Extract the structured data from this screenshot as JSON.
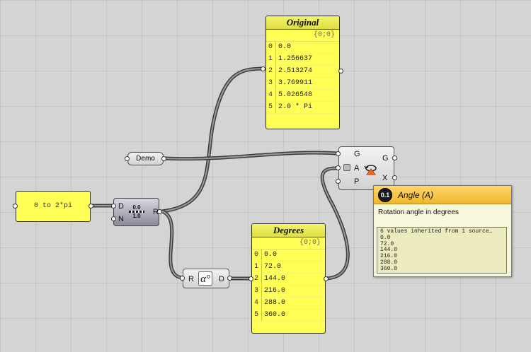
{
  "original_panel": {
    "title": "Original",
    "path": "{0;0}",
    "rows": [
      {
        "index": "0",
        "value": "0.0"
      },
      {
        "index": "1",
        "value": "1.256637"
      },
      {
        "index": "2",
        "value": "2.513274"
      },
      {
        "index": "3",
        "value": "3.769911"
      },
      {
        "index": "4",
        "value": "5.026548"
      },
      {
        "index": "5",
        "value": "2.0 * Pi"
      }
    ]
  },
  "degrees_panel": {
    "title": "Degrees",
    "path": "{0;0}",
    "rows": [
      {
        "index": "0",
        "value": "0.0"
      },
      {
        "index": "1",
        "value": "72.0"
      },
      {
        "index": "2",
        "value": "144.0"
      },
      {
        "index": "3",
        "value": "216.0"
      },
      {
        "index": "4",
        "value": "288.0"
      },
      {
        "index": "5",
        "value": "360.0"
      }
    ]
  },
  "domain_panel": {
    "value": "0 to 2*pi"
  },
  "demo_param": {
    "label": "Demo"
  },
  "range_component": {
    "input_d": "D",
    "input_n": "N",
    "output_r": "R",
    "icon_top": "0.0",
    "icon_bottom": "1.0"
  },
  "degrees_component": {
    "input_r": "R",
    "output_d": "D",
    "icon_glyph": "α°"
  },
  "rotate_component": {
    "input_g": "G",
    "input_a": "A",
    "input_p": "P",
    "output_g": "G",
    "output_x": "X"
  },
  "tooltip": {
    "badge": "0.1",
    "title": "Angle (A)",
    "description": "Rotation angle in degrees",
    "lines": [
      "6 values inherited from 1 source…",
      "0.0",
      "72.0",
      "144.0",
      "216.0",
      "288.0",
      "360.0"
    ]
  },
  "colors": {
    "canvas": "#d4d4d4",
    "panel_yellow": "#ffff55",
    "wire": "#4a4a4a",
    "tooltip_header": "#f0b72f"
  }
}
